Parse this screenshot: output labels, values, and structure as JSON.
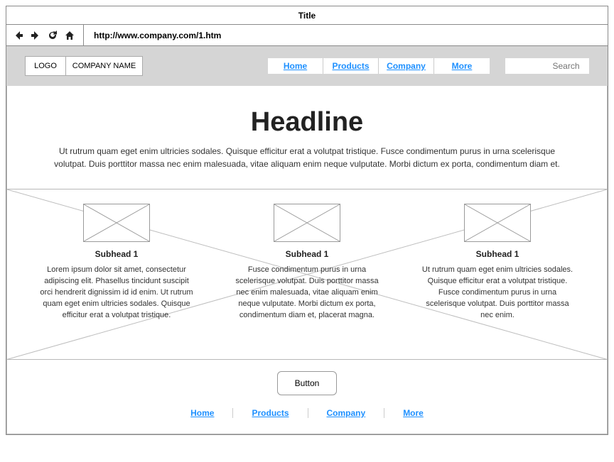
{
  "browser": {
    "title": "Title",
    "url": "http://www.company.com/1.htm"
  },
  "header": {
    "logo_label": "LOGO",
    "company_label": "COMPANY NAME",
    "nav": [
      "Home",
      "Products",
      "Company",
      "More"
    ],
    "search_placeholder": "Search"
  },
  "hero": {
    "headline": "Headline",
    "body": "Ut rutrum quam eget enim ultricies sodales. Quisque efficitur erat a volutpat tristique. Fusce condimentum purus in urna scelerisque volutpat. Duis porttitor massa nec enim malesuada, vitae aliquam enim neque vulputate. Morbi dictum ex porta, condimentum diam et."
  },
  "columns": [
    {
      "title": "Subhead 1",
      "body": "Lorem ipsum dolor sit amet, consectetur adipiscing elit. Phasellus tincidunt suscipit orci hendrerit dignissim id id enim. Ut rutrum quam eget enim ultricies sodales. Quisque efficitur erat a volutpat tristique."
    },
    {
      "title": "Subhead 1",
      "body": "Fusce condimentum purus in urna scelerisque volutpat. Duis porttitor massa nec enim malesuada, vitae aliquam enim neque vulputate. Morbi dictum ex porta, condimentum diam et, placerat magna."
    },
    {
      "title": "Subhead 1",
      "body": "Ut rutrum quam eget enim ultricies sodales. Quisque efficitur erat a volutpat tristique. Fusce condimentum purus in urna scelerisque volutpat. Duis porttitor massa nec enim."
    }
  ],
  "footer": {
    "button_label": "Button",
    "nav": [
      "Home",
      "Products",
      "Company",
      "More"
    ]
  }
}
